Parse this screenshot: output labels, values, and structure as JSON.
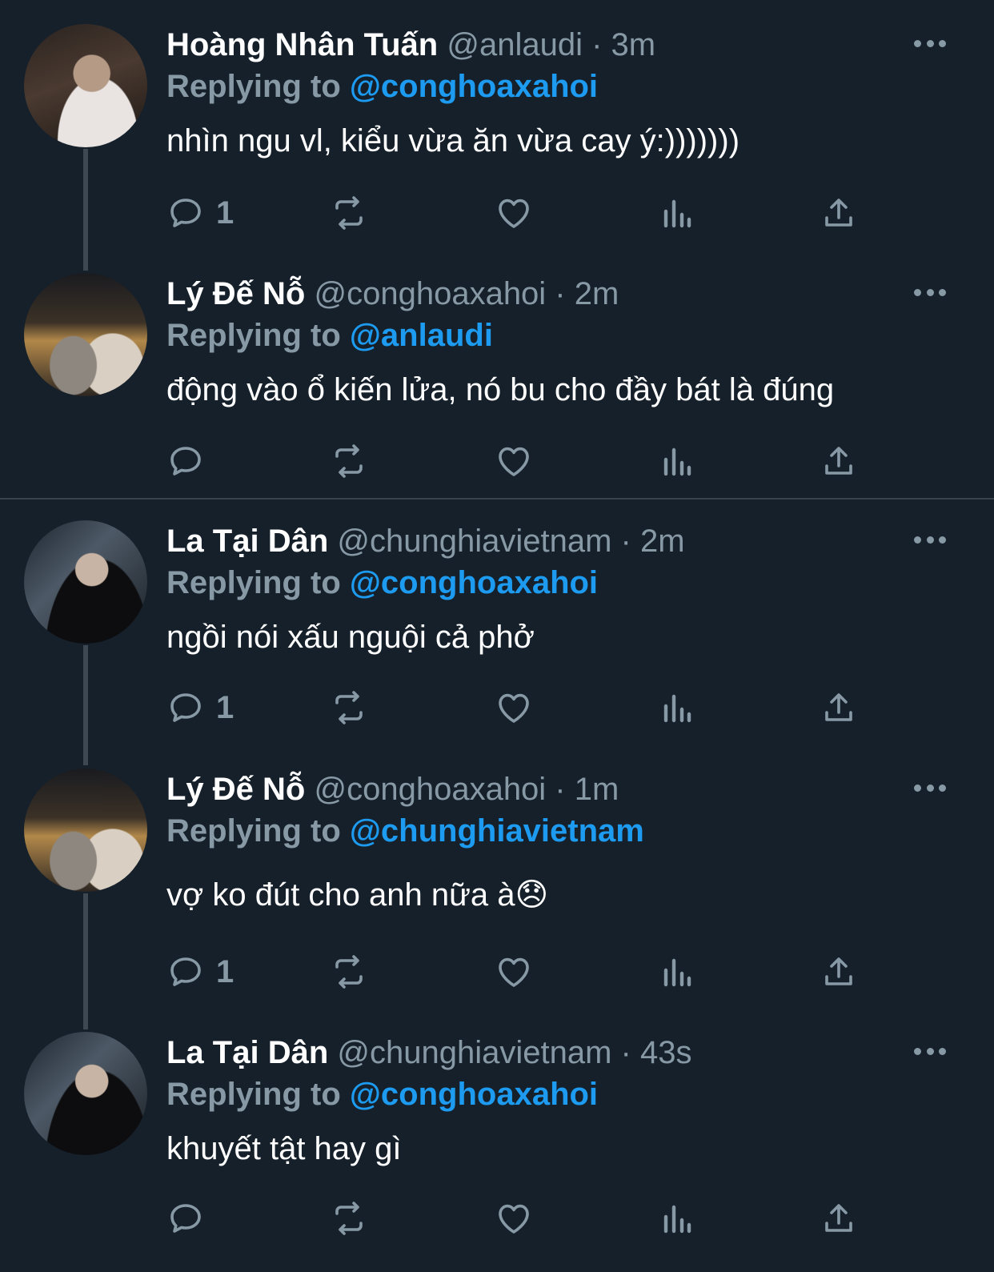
{
  "colors": {
    "background": "#15202b",
    "text": "#ffffff",
    "muted": "#8899a6",
    "link": "#1d9bf0"
  },
  "tweets": [
    {
      "name": "Hoàng Nhân Tuấn",
      "handle_time": "@anlaudi · 3m",
      "replying_label": "Replying to",
      "replying_to": "@conghoaxahoi",
      "text": "nhìn ngu vl, kiểu vừa ăn vừa cay ý:)))))))",
      "reply_count": "1"
    },
    {
      "name": "Lý Đế Nỗ",
      "handle_time": "@conghoaxahoi · 2m",
      "replying_label": "Replying to",
      "replying_to": "@anlaudi",
      "text": "động vào ổ kiến lửa, nó bu cho đầy bát là đúng",
      "reply_count": ""
    },
    {
      "name": "La Tại Dân",
      "handle_time": "@chunghiavietnam · 2m",
      "replying_label": "Replying to",
      "replying_to": "@conghoaxahoi",
      "text": "ngồi nói xấu nguội cả phở",
      "reply_count": "1"
    },
    {
      "name": "Lý Đế Nỗ",
      "handle_time": "@conghoaxahoi · 1m",
      "replying_label": "Replying to",
      "replying_to": "@chunghiavietnam",
      "text": "vợ ko đút cho anh nữa à😞",
      "reply_count": "1"
    },
    {
      "name": "La Tại Dân",
      "handle_time": "@chunghiavietnam · 43s",
      "replying_label": "Replying to",
      "replying_to": "@conghoaxahoi",
      "text": "khuyết tật hay gì",
      "reply_count": ""
    }
  ],
  "icons": [
    "reply-icon",
    "retweet-icon",
    "like-icon",
    "analytics-icon",
    "share-icon",
    "more-icon"
  ]
}
